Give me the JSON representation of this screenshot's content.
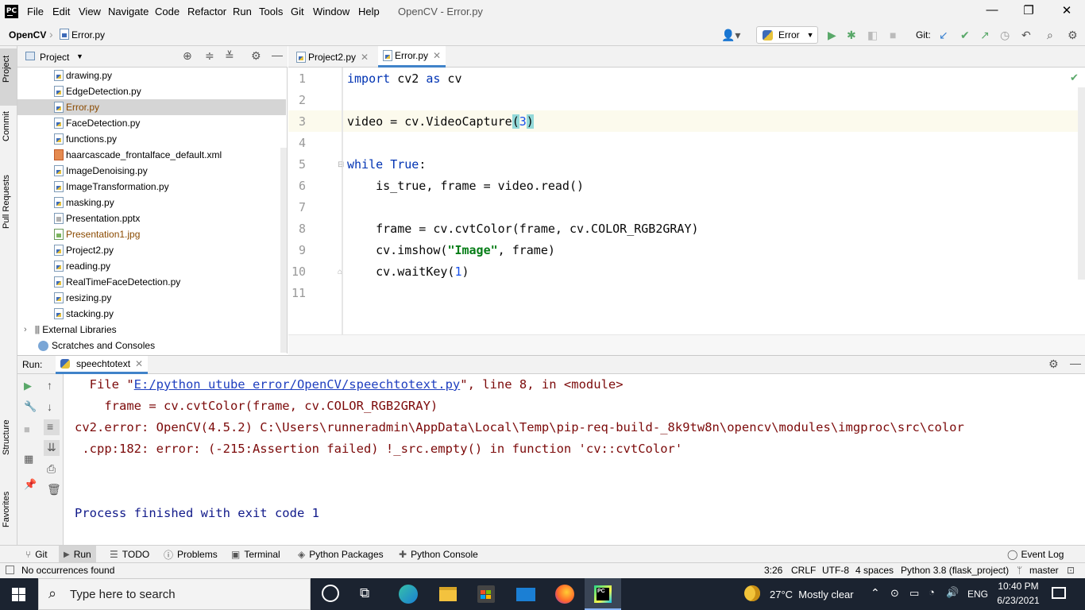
{
  "window": {
    "title": "OpenCV - Error.py",
    "menu": [
      "File",
      "Edit",
      "View",
      "Navigate",
      "Code",
      "Refactor",
      "Run",
      "Tools",
      "Git",
      "Window",
      "Help"
    ],
    "controls": {
      "minimize": "—",
      "maximize": "❐",
      "close": "✕"
    }
  },
  "breadcrumb": {
    "project": "OpenCV",
    "file": "Error.py"
  },
  "toolbar": {
    "run_config": "Error",
    "git_label": "Git:"
  },
  "sidebar_left": [
    "Project",
    "Commit",
    "Pull Requests",
    "Structure",
    "Favorites"
  ],
  "project_panel": {
    "title": "Project",
    "items": [
      {
        "label": "drawing.py",
        "type": "py"
      },
      {
        "label": "EdgeDetection.py",
        "type": "py"
      },
      {
        "label": "Error.py",
        "type": "py",
        "selected": true
      },
      {
        "label": "FaceDetection.py",
        "type": "py"
      },
      {
        "label": "functions.py",
        "type": "py"
      },
      {
        "label": "haarcascade_frontalface_default.xml",
        "type": "xml"
      },
      {
        "label": "ImageDenoising.py",
        "type": "py"
      },
      {
        "label": "ImageTransformation.py",
        "type": "py"
      },
      {
        "label": "masking.py",
        "type": "py"
      },
      {
        "label": "Presentation.pptx",
        "type": "pptx"
      },
      {
        "label": "Presentation1.jpg",
        "type": "jpg"
      },
      {
        "label": "Project2.py",
        "type": "py"
      },
      {
        "label": "reading.py",
        "type": "py"
      },
      {
        "label": "RealTimeFaceDetection.py",
        "type": "py"
      },
      {
        "label": "resizing.py",
        "type": "py"
      },
      {
        "label": "stacking.py",
        "type": "py"
      }
    ],
    "external_libraries": "External Libraries",
    "scratches": "Scratches and Consoles"
  },
  "editor": {
    "tabs": [
      {
        "label": "Project2.py"
      },
      {
        "label": "Error.py",
        "active": true
      }
    ],
    "line_numbers": [
      "1",
      "2",
      "3",
      "4",
      "5",
      "6",
      "7",
      "8",
      "9",
      "10",
      "11"
    ],
    "code": {
      "l1_kw1": "import",
      "l1_mid": " cv2 ",
      "l1_kw2": "as",
      "l1_end": " cv",
      "l3_a": "video = cv.VideoCapture",
      "l3_open": "(",
      "l3_num": "3",
      "l3_close": ")",
      "l5_kw1": "while",
      "l5_sp": " ",
      "l5_kw2": "True",
      "l5_end": ":",
      "l6": "    is_true, frame = video.read()",
      "l8": "    frame = cv.cvtColor(frame, cv.COLOR_RGB2GRAY)",
      "l9_a": "    cv.imshow(",
      "l9_str": "\"Image\"",
      "l9_b": ", frame)",
      "l10_a": "    cv.waitKey(",
      "l10_num": "1",
      "l10_b": ")"
    }
  },
  "run_panel": {
    "label": "Run:",
    "tab": "speechtotext",
    "output": {
      "line1_a": "  File \"",
      "line1_link": "E:/python utube error/OpenCV/speechtotext.py",
      "line1_b": "\", line 8, in <module>",
      "line2": "    frame = cv.cvtColor(frame, cv.COLOR_RGB2GRAY)",
      "line3": "cv2.error: OpenCV(4.5.2) C:\\Users\\runneradmin\\AppData\\Local\\Temp\\pip-req-build-_8k9tw8n\\opencv\\modules\\imgproc\\src\\color",
      "line4": " .cpp:182: error: (-215:Assertion failed) !_src.empty() in function 'cv::cvtColor'",
      "line5": "Process finished with exit code 1"
    }
  },
  "bottom_tools": [
    "Git",
    "Run",
    "TODO",
    "Problems",
    "Terminal",
    "Python Packages",
    "Python Console"
  ],
  "event_log": "Event Log",
  "status": {
    "message": "No occurrences found",
    "position": "3:26",
    "line_sep": "CRLF",
    "encoding": "UTF-8",
    "indent": "4 spaces",
    "interpreter": "Python 3.8 (flask_project)",
    "branch": "master"
  },
  "taskbar": {
    "search_placeholder": "Type here to search",
    "weather": "27°C  Mostly clear",
    "lang": "ENG",
    "time": "10:40 PM",
    "date": "6/23/2021"
  }
}
